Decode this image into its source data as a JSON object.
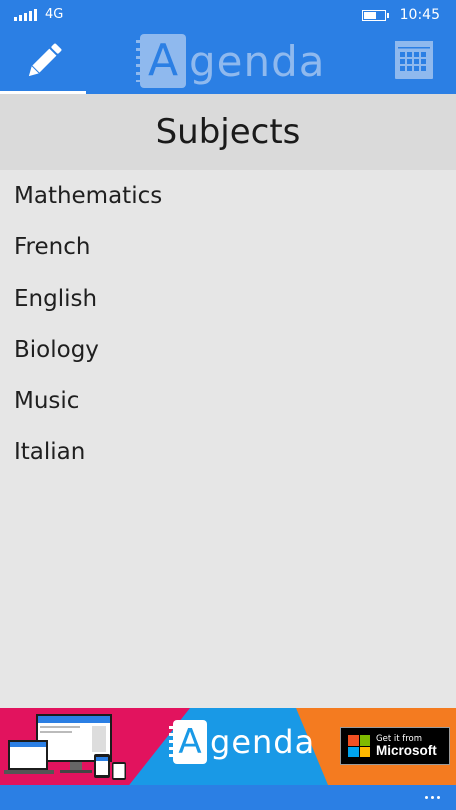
{
  "status_bar": {
    "network": "4G",
    "time": "10:45",
    "battery_level": 0.55,
    "icons": [
      "signal-icon",
      "battery-icon"
    ]
  },
  "app_bar": {
    "logo_letter": "A",
    "logo_rest": "genda",
    "active_tab": "edit",
    "icons": [
      "pencil-icon",
      "calendar-icon"
    ],
    "accent_color": "#2b7fe4"
  },
  "page": {
    "title": "Subjects"
  },
  "subjects": [
    "Mathematics",
    "French",
    "English",
    "Biology",
    "Music",
    "Italian"
  ],
  "ad": {
    "logo_letter": "A",
    "logo_rest": "genda",
    "badge_small": "Get it from",
    "badge_big": "Microsoft",
    "colors": {
      "pink": "#e2135e",
      "blue": "#1999e6",
      "orange": "#f47b20"
    }
  },
  "bottom_bar": {
    "icons": [
      "more-icon"
    ]
  }
}
